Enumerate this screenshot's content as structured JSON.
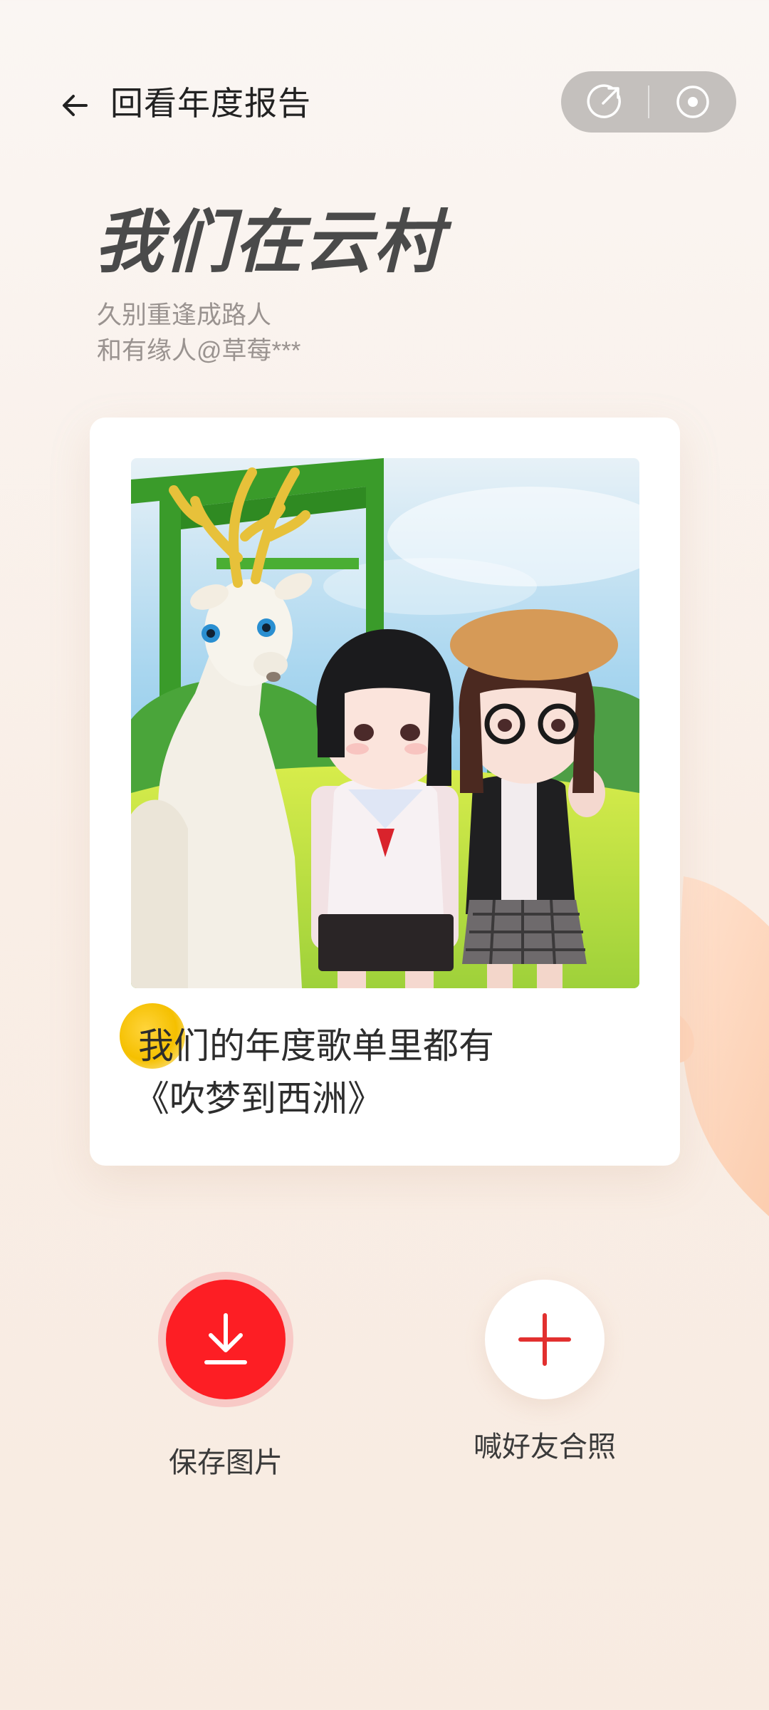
{
  "header": {
    "title": "回看年度报告",
    "back_icon": "arrow-left-icon",
    "share_icon": "share-icon",
    "target_icon": "target-icon"
  },
  "hero": {
    "title": "我们在云村",
    "subtitle_line1": "久别重逢成路人",
    "subtitle_line2": "和有缘人@草莓***"
  },
  "card": {
    "caption_line1": "我们的年度歌单里都有",
    "caption_line2": "《吹梦到西洲》",
    "photo_alt": "illustration-deer-and-two-girls"
  },
  "actions": {
    "save_label": "保存图片",
    "save_icon": "download-icon",
    "invite_label": "喊好友合照",
    "invite_icon": "plus-icon"
  },
  "colors": {
    "accent": "#fd1e24",
    "background": "#f9eee6",
    "caption_dot": "#f5c000"
  }
}
